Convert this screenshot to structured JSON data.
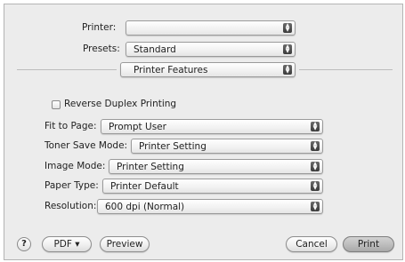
{
  "printer": {
    "label": "Printer:",
    "value": ""
  },
  "presets": {
    "label": "Presets:",
    "value": "Standard"
  },
  "pane_selector": {
    "value": "Printer Features"
  },
  "reverse_duplex": {
    "label": "Reverse Duplex Printing",
    "checked": false
  },
  "fit_to_page": {
    "label": "Fit to Page:",
    "value": "Prompt User"
  },
  "toner_save": {
    "label": "Toner Save Mode:",
    "value": "Printer Setting"
  },
  "image_mode": {
    "label": "Image Mode:",
    "value": "Printer Setting"
  },
  "paper_type": {
    "label": "Paper Type:",
    "value": "Printer Default"
  },
  "resolution": {
    "label": "Resolution:",
    "value": "600 dpi (Normal)"
  },
  "buttons": {
    "help": "?",
    "pdf": "PDF ▾",
    "preview": "Preview",
    "cancel": "Cancel",
    "print": "Print"
  },
  "popup_arrow_glyph": "▲▼"
}
